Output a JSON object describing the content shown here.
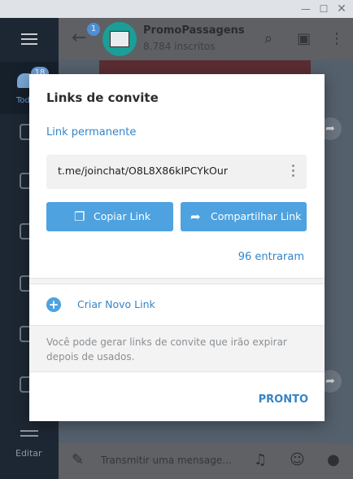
{
  "window": {
    "controls": [
      "—",
      "☐",
      "✕"
    ]
  },
  "sidebar": {
    "all_chats": {
      "label": "Todos",
      "badge": "18"
    },
    "edit_label": "Editar"
  },
  "chat_header": {
    "unread_badge": "1",
    "title": "PromoPassagens",
    "subtitle": "8.784 inscritos"
  },
  "composer": {
    "placeholder": "Transmitir uma mensage..."
  },
  "modal": {
    "title": "Links de convite",
    "permanent_link_label": "Link permanente",
    "link_value": "t.me/joinchat/O8L8X86kIPCYkOur",
    "copy_button": "Copiar Link",
    "share_button": "Compartilhar Link",
    "joined_text": "96 entraram",
    "create_link_label": "Criar Novo Link",
    "info_text": "Você pode gerar links de convite que irão expirar depois de usados.",
    "done_button": "PRONTO"
  },
  "colors": {
    "accent": "#3584c7",
    "button": "#4ea2e0",
    "sidebar": "#1d2733"
  }
}
